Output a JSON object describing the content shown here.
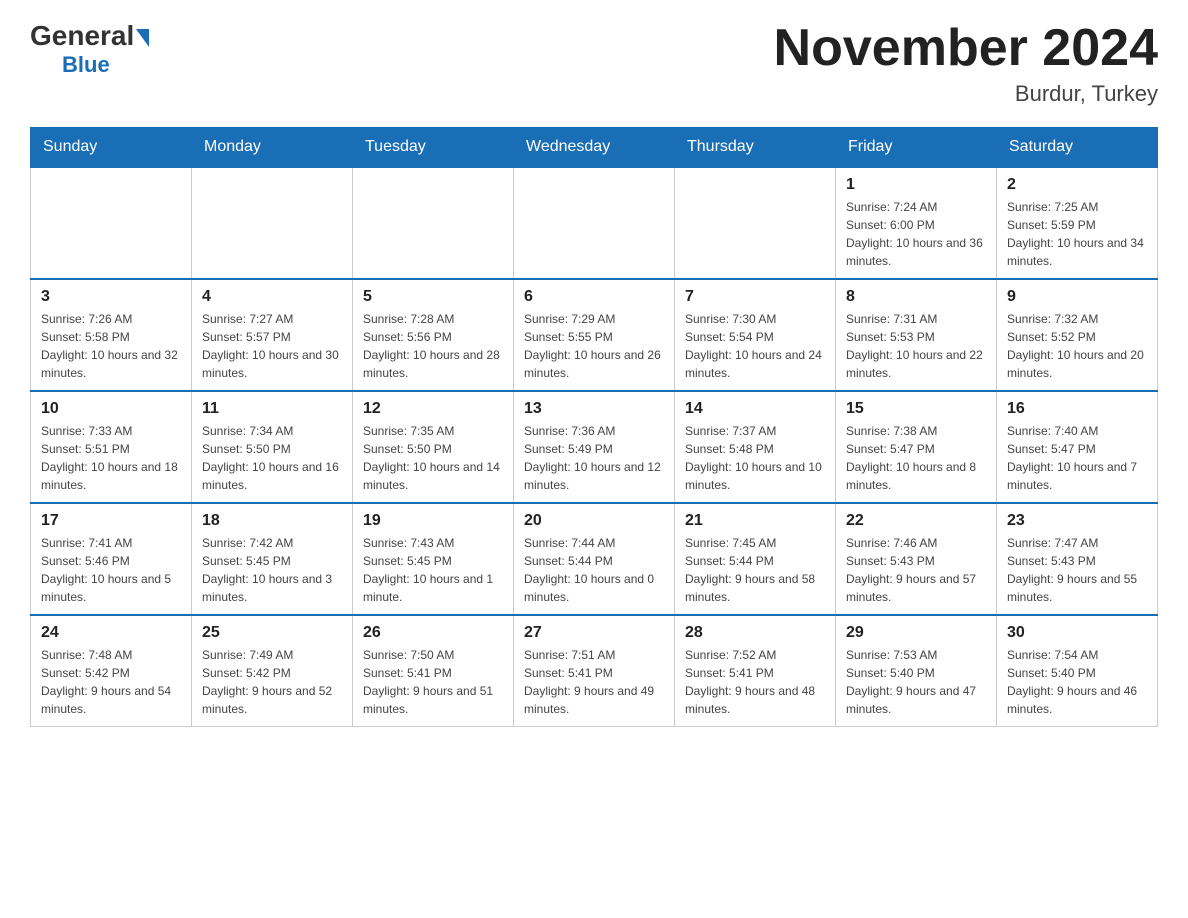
{
  "header": {
    "logo_general": "General",
    "logo_triangle": "",
    "logo_blue": "Blue",
    "month_title": "November 2024",
    "location": "Burdur, Turkey"
  },
  "days_of_week": [
    "Sunday",
    "Monday",
    "Tuesday",
    "Wednesday",
    "Thursday",
    "Friday",
    "Saturday"
  ],
  "weeks": [
    [
      {
        "day": "",
        "info": ""
      },
      {
        "day": "",
        "info": ""
      },
      {
        "day": "",
        "info": ""
      },
      {
        "day": "",
        "info": ""
      },
      {
        "day": "",
        "info": ""
      },
      {
        "day": "1",
        "info": "Sunrise: 7:24 AM\nSunset: 6:00 PM\nDaylight: 10 hours and 36 minutes."
      },
      {
        "day": "2",
        "info": "Sunrise: 7:25 AM\nSunset: 5:59 PM\nDaylight: 10 hours and 34 minutes."
      }
    ],
    [
      {
        "day": "3",
        "info": "Sunrise: 7:26 AM\nSunset: 5:58 PM\nDaylight: 10 hours and 32 minutes."
      },
      {
        "day": "4",
        "info": "Sunrise: 7:27 AM\nSunset: 5:57 PM\nDaylight: 10 hours and 30 minutes."
      },
      {
        "day": "5",
        "info": "Sunrise: 7:28 AM\nSunset: 5:56 PM\nDaylight: 10 hours and 28 minutes."
      },
      {
        "day": "6",
        "info": "Sunrise: 7:29 AM\nSunset: 5:55 PM\nDaylight: 10 hours and 26 minutes."
      },
      {
        "day": "7",
        "info": "Sunrise: 7:30 AM\nSunset: 5:54 PM\nDaylight: 10 hours and 24 minutes."
      },
      {
        "day": "8",
        "info": "Sunrise: 7:31 AM\nSunset: 5:53 PM\nDaylight: 10 hours and 22 minutes."
      },
      {
        "day": "9",
        "info": "Sunrise: 7:32 AM\nSunset: 5:52 PM\nDaylight: 10 hours and 20 minutes."
      }
    ],
    [
      {
        "day": "10",
        "info": "Sunrise: 7:33 AM\nSunset: 5:51 PM\nDaylight: 10 hours and 18 minutes."
      },
      {
        "day": "11",
        "info": "Sunrise: 7:34 AM\nSunset: 5:50 PM\nDaylight: 10 hours and 16 minutes."
      },
      {
        "day": "12",
        "info": "Sunrise: 7:35 AM\nSunset: 5:50 PM\nDaylight: 10 hours and 14 minutes."
      },
      {
        "day": "13",
        "info": "Sunrise: 7:36 AM\nSunset: 5:49 PM\nDaylight: 10 hours and 12 minutes."
      },
      {
        "day": "14",
        "info": "Sunrise: 7:37 AM\nSunset: 5:48 PM\nDaylight: 10 hours and 10 minutes."
      },
      {
        "day": "15",
        "info": "Sunrise: 7:38 AM\nSunset: 5:47 PM\nDaylight: 10 hours and 8 minutes."
      },
      {
        "day": "16",
        "info": "Sunrise: 7:40 AM\nSunset: 5:47 PM\nDaylight: 10 hours and 7 minutes."
      }
    ],
    [
      {
        "day": "17",
        "info": "Sunrise: 7:41 AM\nSunset: 5:46 PM\nDaylight: 10 hours and 5 minutes."
      },
      {
        "day": "18",
        "info": "Sunrise: 7:42 AM\nSunset: 5:45 PM\nDaylight: 10 hours and 3 minutes."
      },
      {
        "day": "19",
        "info": "Sunrise: 7:43 AM\nSunset: 5:45 PM\nDaylight: 10 hours and 1 minute."
      },
      {
        "day": "20",
        "info": "Sunrise: 7:44 AM\nSunset: 5:44 PM\nDaylight: 10 hours and 0 minutes."
      },
      {
        "day": "21",
        "info": "Sunrise: 7:45 AM\nSunset: 5:44 PM\nDaylight: 9 hours and 58 minutes."
      },
      {
        "day": "22",
        "info": "Sunrise: 7:46 AM\nSunset: 5:43 PM\nDaylight: 9 hours and 57 minutes."
      },
      {
        "day": "23",
        "info": "Sunrise: 7:47 AM\nSunset: 5:43 PM\nDaylight: 9 hours and 55 minutes."
      }
    ],
    [
      {
        "day": "24",
        "info": "Sunrise: 7:48 AM\nSunset: 5:42 PM\nDaylight: 9 hours and 54 minutes."
      },
      {
        "day": "25",
        "info": "Sunrise: 7:49 AM\nSunset: 5:42 PM\nDaylight: 9 hours and 52 minutes."
      },
      {
        "day": "26",
        "info": "Sunrise: 7:50 AM\nSunset: 5:41 PM\nDaylight: 9 hours and 51 minutes."
      },
      {
        "day": "27",
        "info": "Sunrise: 7:51 AM\nSunset: 5:41 PM\nDaylight: 9 hours and 49 minutes."
      },
      {
        "day": "28",
        "info": "Sunrise: 7:52 AM\nSunset: 5:41 PM\nDaylight: 9 hours and 48 minutes."
      },
      {
        "day": "29",
        "info": "Sunrise: 7:53 AM\nSunset: 5:40 PM\nDaylight: 9 hours and 47 minutes."
      },
      {
        "day": "30",
        "info": "Sunrise: 7:54 AM\nSunset: 5:40 PM\nDaylight: 9 hours and 46 minutes."
      }
    ]
  ]
}
